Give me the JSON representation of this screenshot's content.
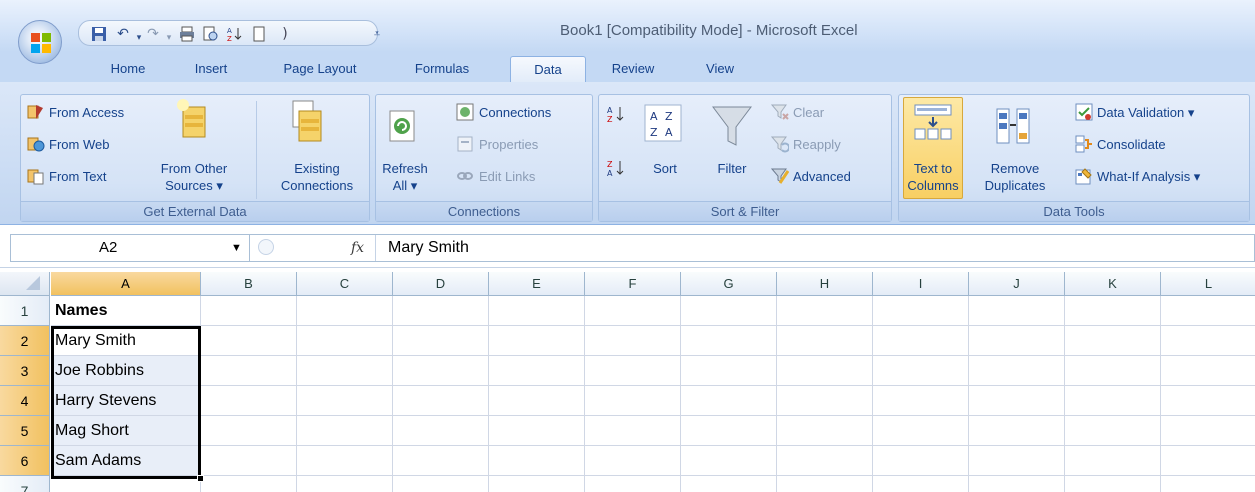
{
  "window": {
    "title": "Book1  [Compatibility Mode]  -  Microsoft Excel"
  },
  "quick_access": {
    "icons": [
      "save-icon",
      "undo-icon",
      "redo-icon",
      "print-preview-icon",
      "print-icon",
      "sort-ascending-icon",
      "new-document-icon",
      "customize-qat-icon"
    ]
  },
  "tabs": [
    "Home",
    "Insert",
    "Page Layout",
    "Formulas",
    "Data",
    "Review",
    "View"
  ],
  "active_tab": "Data",
  "ribbon": {
    "get_external_data": {
      "label": "Get External Data",
      "from_access": "From Access",
      "from_web": "From Web",
      "from_text": "From Text",
      "from_other_line1": "From Other",
      "from_other_line2": "Sources ▾",
      "existing_line1": "Existing",
      "existing_line2": "Connections"
    },
    "connections": {
      "label": "Connections",
      "refresh_line1": "Refresh",
      "refresh_line2": "All ▾",
      "connections": "Connections",
      "properties": "Properties",
      "edit_links": "Edit Links"
    },
    "sort_filter": {
      "label": "Sort & Filter",
      "sort": "Sort",
      "filter": "Filter",
      "clear": "Clear",
      "reapply": "Reapply",
      "advanced": "Advanced"
    },
    "data_tools": {
      "label": "Data Tools",
      "text_to_columns_line1": "Text to",
      "text_to_columns_line2": "Columns",
      "remove_dup_line1": "Remove",
      "remove_dup_line2": "Duplicates",
      "data_validation": "Data Validation ▾",
      "consolidate": "Consolidate",
      "what_if": "What-If Analysis ▾"
    }
  },
  "formula_bar": {
    "name_box": "A2",
    "fx": "fx",
    "value": "Mary Smith"
  },
  "grid": {
    "columns": [
      "A",
      "B",
      "C",
      "D",
      "E",
      "F",
      "G",
      "H",
      "I",
      "J",
      "K",
      "L"
    ],
    "rows": [
      "1",
      "2",
      "3",
      "4",
      "5",
      "6",
      "7"
    ],
    "selected_column": "A",
    "selected_rows": [
      "2",
      "3",
      "4",
      "5",
      "6"
    ],
    "cells": {
      "A1": "Names",
      "A2": "Mary Smith",
      "A3": "Joe Robbins",
      "A4": "Harry Stevens",
      "A5": "Mag Short",
      "A6": "Sam Adams"
    }
  },
  "colors": {
    "selection": "#000000",
    "header_selected": "#f1c15f",
    "ribbon": "#c9dbf3"
  }
}
